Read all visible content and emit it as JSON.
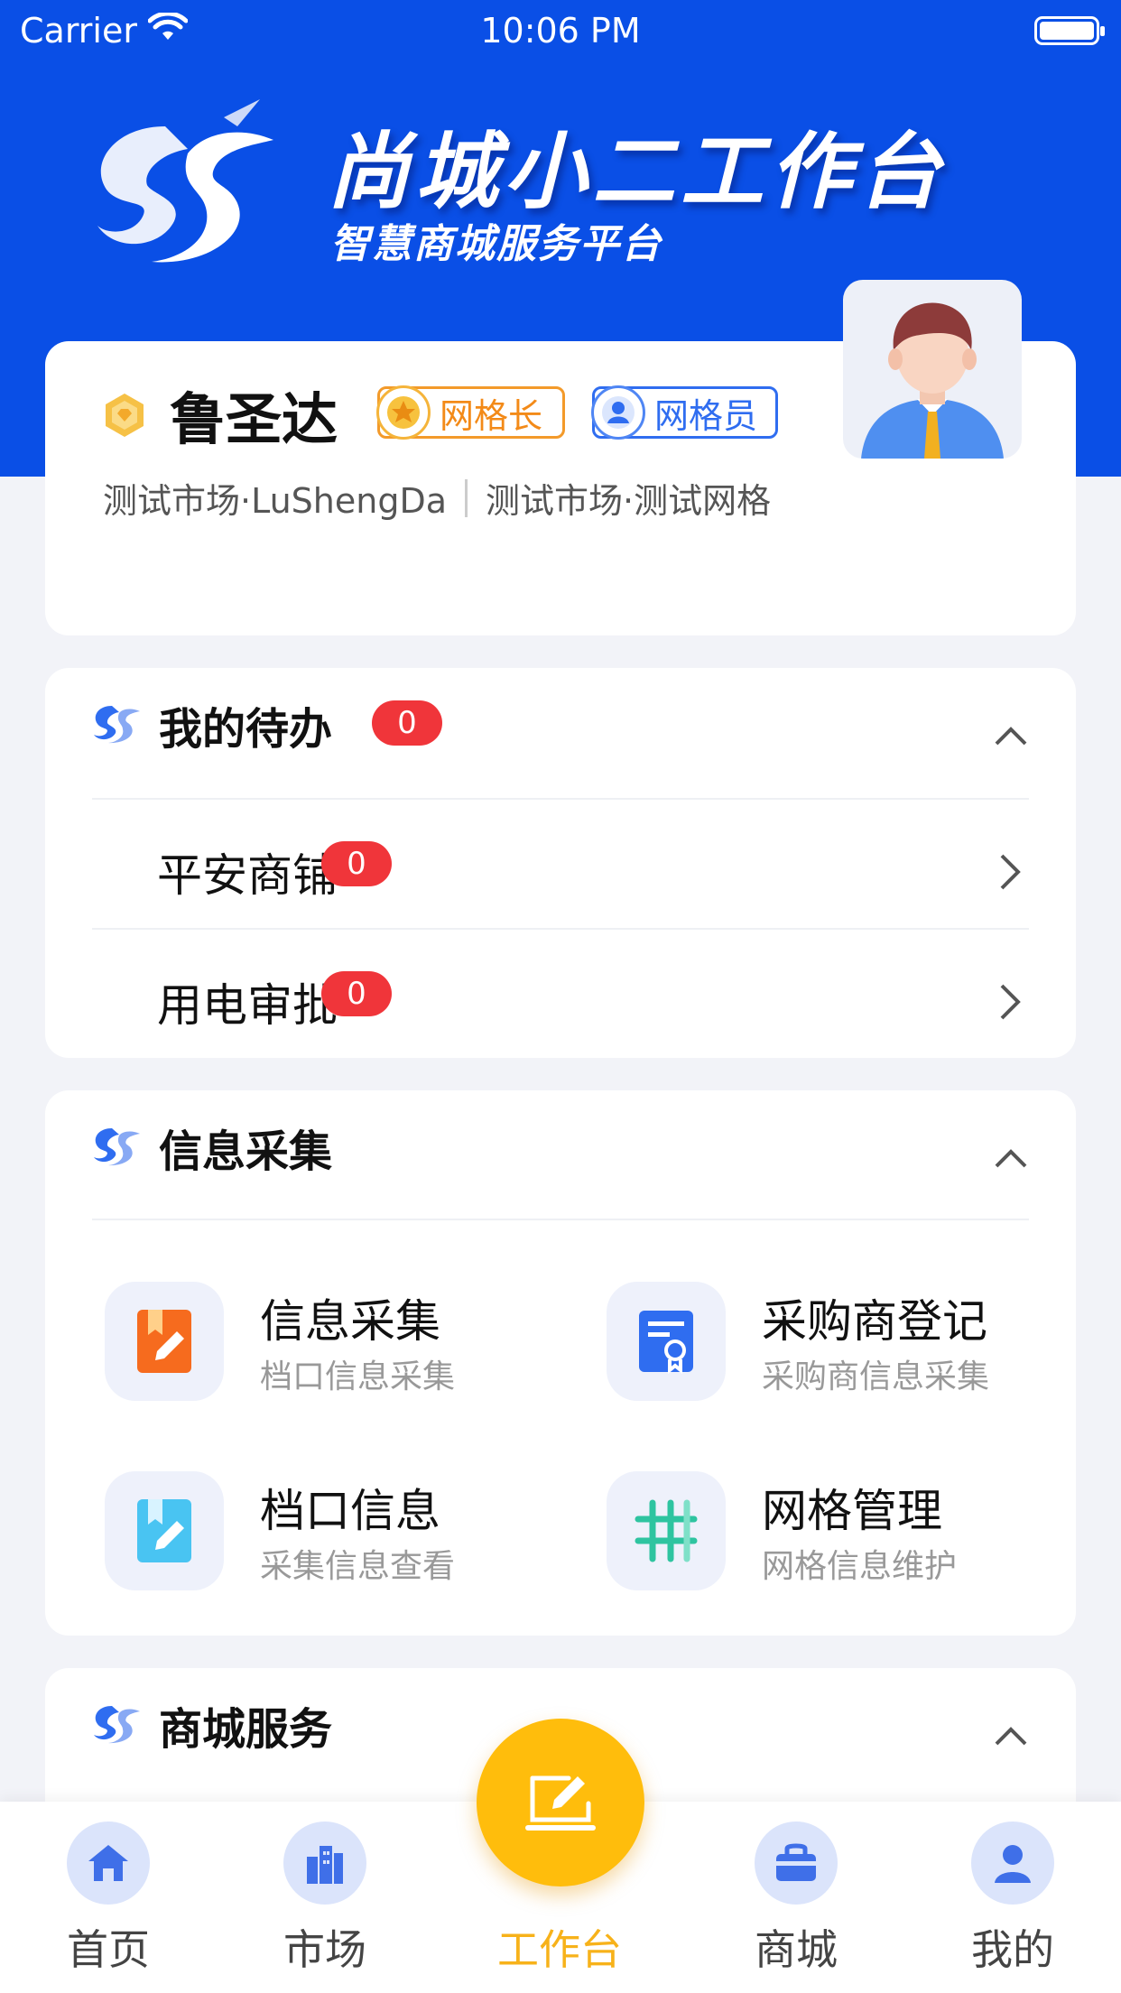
{
  "status_bar": {
    "carrier": "Carrier",
    "time": "10:06 PM"
  },
  "brand": {
    "title": "尚城小二工作台",
    "subtitle": "智慧商城服务平台",
    "accent": "#0a4fe6"
  },
  "profile": {
    "name": "鲁圣达",
    "roles": [
      {
        "label": "网格长",
        "color": "#f38a18",
        "icon": "star-icon"
      },
      {
        "label": "网格员",
        "color": "#2f6df0",
        "icon": "person-icon"
      }
    ],
    "market_user": "测试市场·LuShengDa",
    "market_grid": "测试市场·测试网格"
  },
  "todo": {
    "title": "我的待办",
    "count": "0",
    "items": [
      {
        "label": "平安商铺",
        "count": "0"
      },
      {
        "label": "用电审批",
        "count": "0"
      }
    ]
  },
  "collect": {
    "title": "信息采集",
    "tiles": [
      {
        "title": "信息采集",
        "subtitle": "档口信息采集",
        "icon": "edit-doc-icon"
      },
      {
        "title": "采购商登记",
        "subtitle": "采购商信息采集",
        "icon": "certificate-icon"
      },
      {
        "title": "档口信息",
        "subtitle": "采集信息查看",
        "icon": "bookmark-edit-icon"
      },
      {
        "title": "网格管理",
        "subtitle": "网格信息维护",
        "icon": "grid-icon"
      }
    ]
  },
  "mall": {
    "title": "商城服务"
  },
  "tabbar": {
    "items": [
      {
        "label": "首页",
        "icon": "home-icon"
      },
      {
        "label": "市场",
        "icon": "buildings-icon"
      },
      {
        "label": "工作台",
        "icon": "edit-icon",
        "active": true
      },
      {
        "label": "商城",
        "icon": "shop-bag-icon"
      },
      {
        "label": "我的",
        "icon": "user-icon"
      }
    ],
    "active_color": "#f7b21a"
  }
}
